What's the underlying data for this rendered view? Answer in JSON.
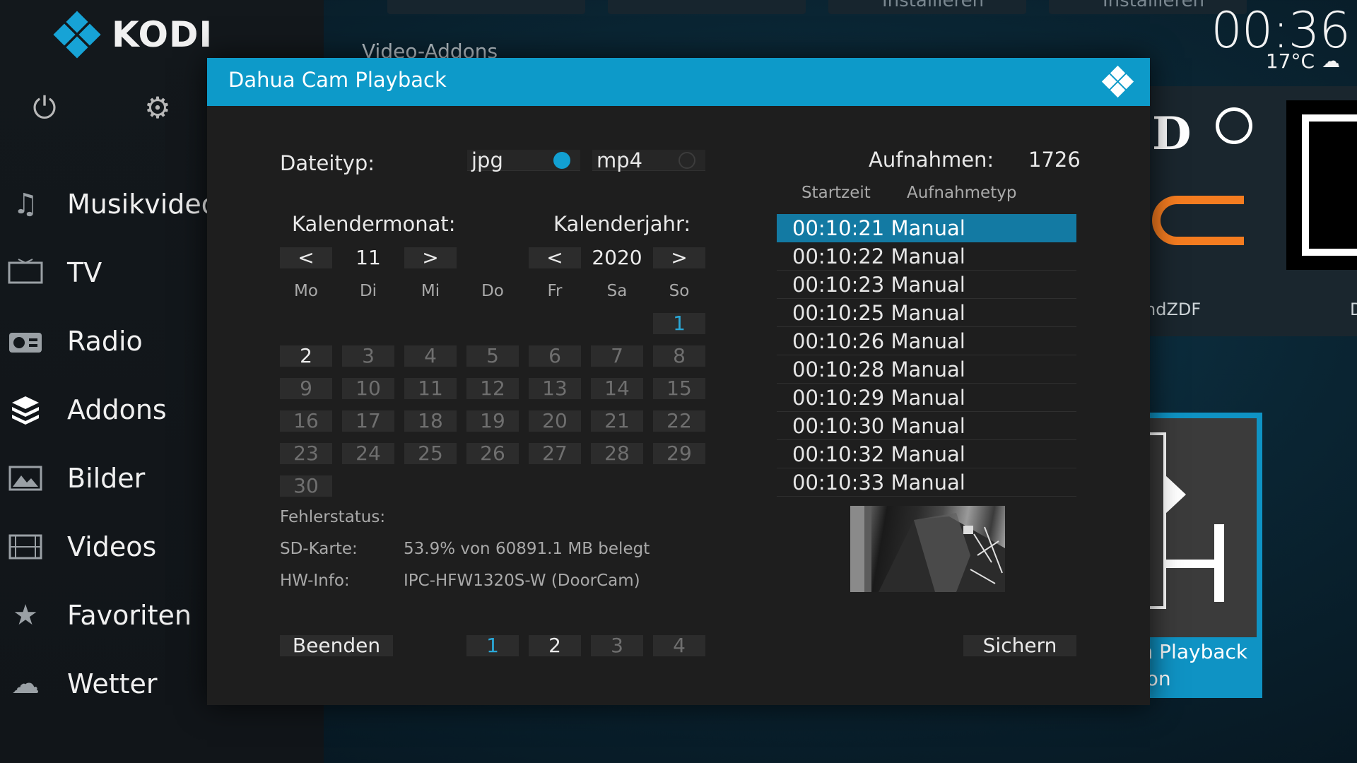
{
  "app": {
    "logo_text": "KODI",
    "accent": "#0d9ac9"
  },
  "sidebar": {
    "power_icon": "power-icon",
    "settings_icon": "gear-icon",
    "items": [
      {
        "label": "Musikvideos",
        "icon": "music-video-icon"
      },
      {
        "label": "TV",
        "icon": "tv-icon"
      },
      {
        "label": "Radio",
        "icon": "radio-icon"
      },
      {
        "label": "Addons",
        "icon": "addons-box-icon"
      },
      {
        "label": "Bilder",
        "icon": "picture-icon"
      },
      {
        "label": "Videos",
        "icon": "film-icon"
      },
      {
        "label": "Favoriten",
        "icon": "star-icon"
      },
      {
        "label": "Wetter",
        "icon": "weather-icon"
      }
    ]
  },
  "background": {
    "breadcrumb": "Video-Addons",
    "top_tiles": [
      "Installieren",
      "Installieren"
    ],
    "clock": "00:36",
    "temperature": "17°C",
    "tile_labels": [
      "ndZDF",
      "D",
      "m Playback",
      "don"
    ]
  },
  "dialog": {
    "title": "Dahua Cam Playback",
    "filetype_label": "Dateityp:",
    "filetype_options": [
      {
        "label": "jpg",
        "selected": true
      },
      {
        "label": "mp4",
        "selected": false
      }
    ],
    "month_label": "Kalendermonat:",
    "year_label": "Kalenderjahr:",
    "prev_symbol": "<",
    "next_symbol": ">",
    "month_value": "11",
    "year_value": "2020",
    "weekdays": [
      "Mo",
      "Di",
      "Mi",
      "Do",
      "Fr",
      "Sa",
      "So"
    ],
    "calendar_days": [
      "1",
      "2",
      "3",
      "4",
      "5",
      "6",
      "7",
      "8",
      "9",
      "10",
      "11",
      "12",
      "13",
      "14",
      "15",
      "16",
      "17",
      "18",
      "19",
      "20",
      "21",
      "22",
      "23",
      "24",
      "25",
      "26",
      "27",
      "28",
      "29",
      "30"
    ],
    "selected_day": "1",
    "active_days": [
      "2"
    ],
    "error_label": "Fehlerstatus:",
    "error_value": "",
    "sd_label": "SD-Karte:",
    "sd_value": "53.9% von 60891.1 MB belegt",
    "hw_label": "HW-Info:",
    "hw_value": "IPC-HFW1320S-W (DoorCam)",
    "recordings_label": "Aufnahmen:",
    "recordings_count": "1726",
    "col_start": "Startzeit",
    "col_type": "Aufnahmetyp",
    "recordings": [
      "00:10:21 Manual",
      "00:10:22 Manual",
      "00:10:23 Manual",
      "00:10:25 Manual",
      "00:10:26 Manual",
      "00:10:28 Manual",
      "00:10:29 Manual",
      "00:10:30 Manual",
      "00:10:32 Manual",
      "00:10:33 Manual"
    ],
    "selected_recording_index": 0,
    "quit_button": "Beenden",
    "save_button": "Sichern",
    "pages": [
      "1",
      "2",
      "3",
      "4"
    ],
    "current_page": "1"
  }
}
